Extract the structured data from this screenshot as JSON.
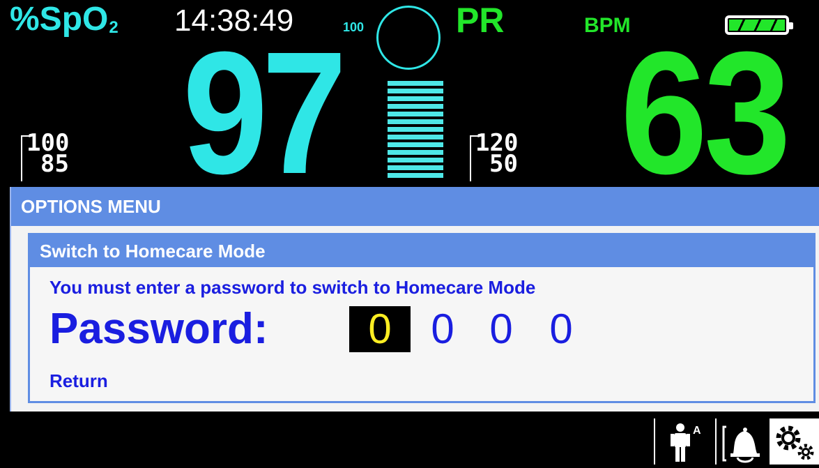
{
  "header": {
    "spo2_label": "%SpO",
    "spo2_sub": "2",
    "time": "14:38:49",
    "pleth_max": "100",
    "pr_label": "PR",
    "bpm_label": "BPM"
  },
  "vitals": {
    "spo2_value": "97",
    "pr_value": "63",
    "spo2_limit_high": "100",
    "spo2_limit_low": "85",
    "pr_limit_high": "120",
    "pr_limit_low": "50",
    "pleth_bar_segments": 13
  },
  "battery": {
    "level": 1.0,
    "color": "#22e62a"
  },
  "options_menu": {
    "title": "OPTIONS MENU",
    "dialog": {
      "title": "Switch to Homecare Mode",
      "message": "You must enter a password to switch to Homecare Mode",
      "password_label": "Password:",
      "digits": [
        "0",
        "0",
        "0",
        "0"
      ],
      "selected_digit_index": 0,
      "return_label": "Return"
    }
  },
  "bottom_bar": {
    "icons": [
      "patient-adult-icon",
      "alarm-bell-icon",
      "settings-gears-icon"
    ],
    "patient_mode_letter": "A"
  },
  "colors": {
    "spo2": "#2fe6e6",
    "pr": "#22e62a",
    "menu_accent": "#5f8de3",
    "text_blue": "#1a1ee0",
    "selected_digit": "#ffee22"
  }
}
